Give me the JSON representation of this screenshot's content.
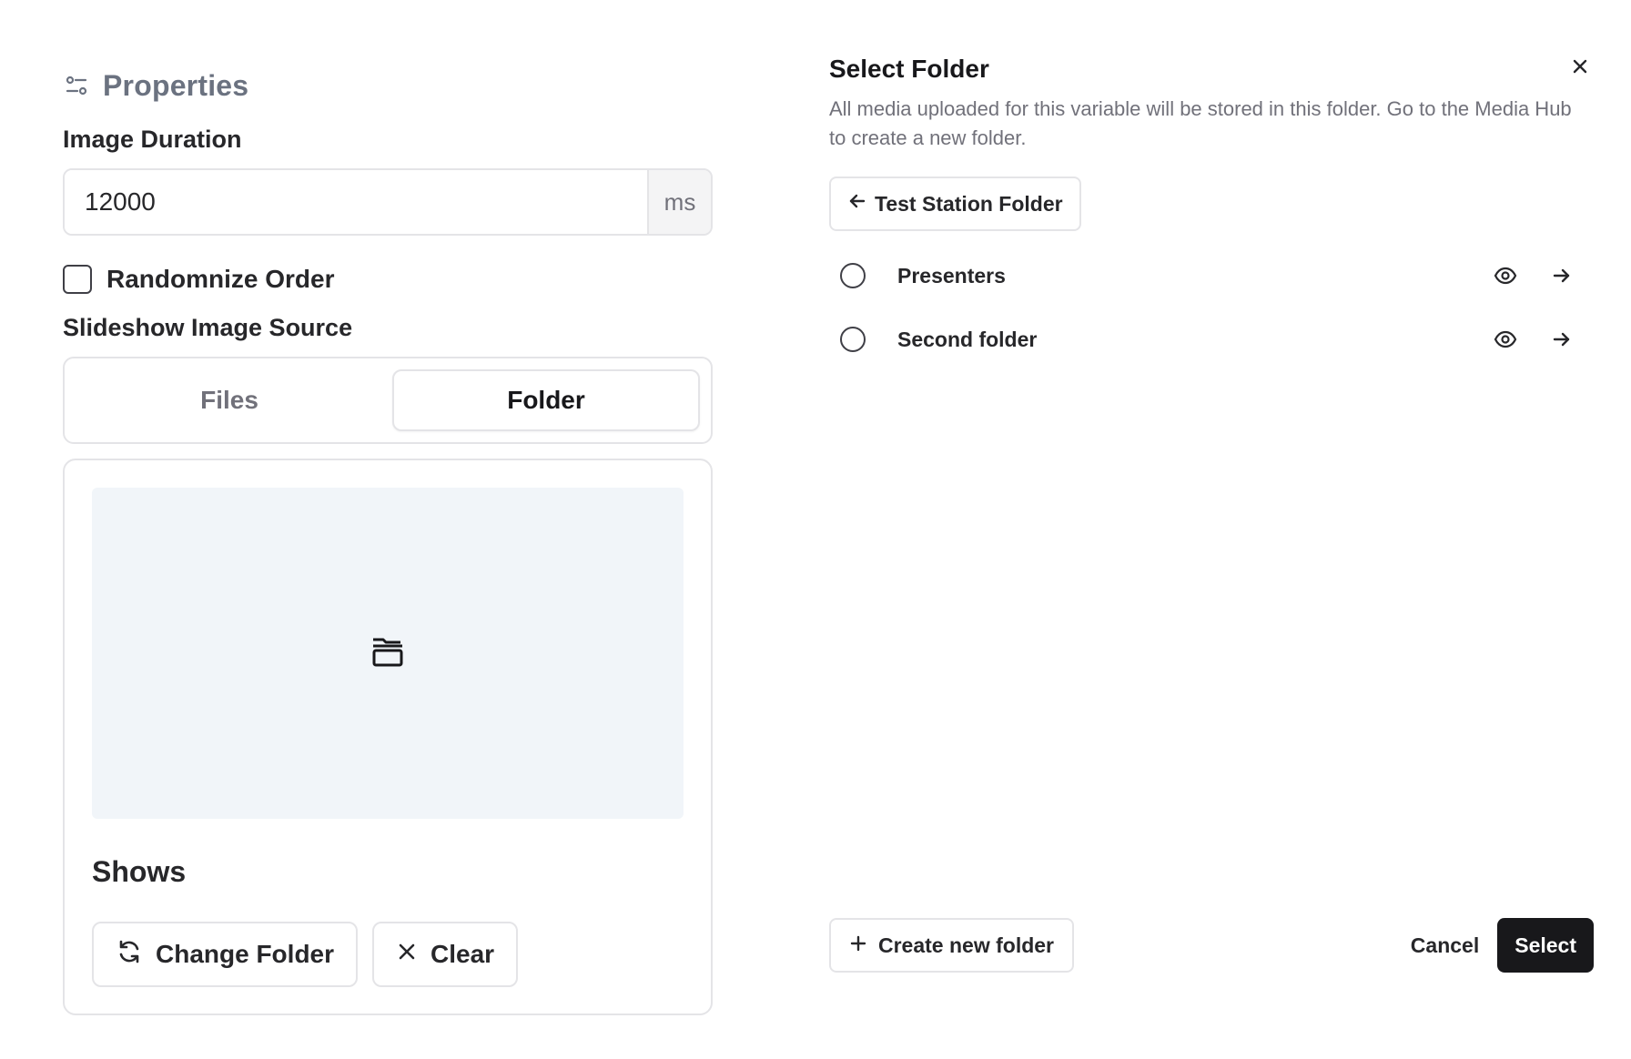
{
  "properties": {
    "title": "Properties",
    "header_icon": "sliders-icon",
    "image_duration": {
      "label": "Image Duration",
      "value": "12000",
      "suffix": "ms"
    },
    "randomize": {
      "label": "Randomnize Order",
      "checked": false
    },
    "source": {
      "label": "Slideshow Image Source",
      "tabs": [
        "Files",
        "Folder"
      ],
      "active_tab": "Folder"
    },
    "folder_card": {
      "preview_icon": "folder-open-icon",
      "folder_name": "Shows",
      "change_label": "Change Folder",
      "change_icon": "refresh-icon",
      "clear_label": "Clear",
      "clear_icon": "close-icon"
    }
  },
  "dialog": {
    "title": "Select Folder",
    "description": "All media uploaded for this variable will be stored in this folder. Go to the Media Hub to create a new folder.",
    "back_label": "Test Station Folder",
    "folders": [
      {
        "name": "Presenters",
        "selected": false
      },
      {
        "name": "Second folder",
        "selected": false
      }
    ],
    "create_label": "Create new folder",
    "cancel_label": "Cancel",
    "select_label": "Select"
  },
  "colors": {
    "primary_button": "#18181b",
    "border": "#e4e4e7",
    "preview_bg": "#f1f5f9",
    "muted_text": "#71717a"
  }
}
